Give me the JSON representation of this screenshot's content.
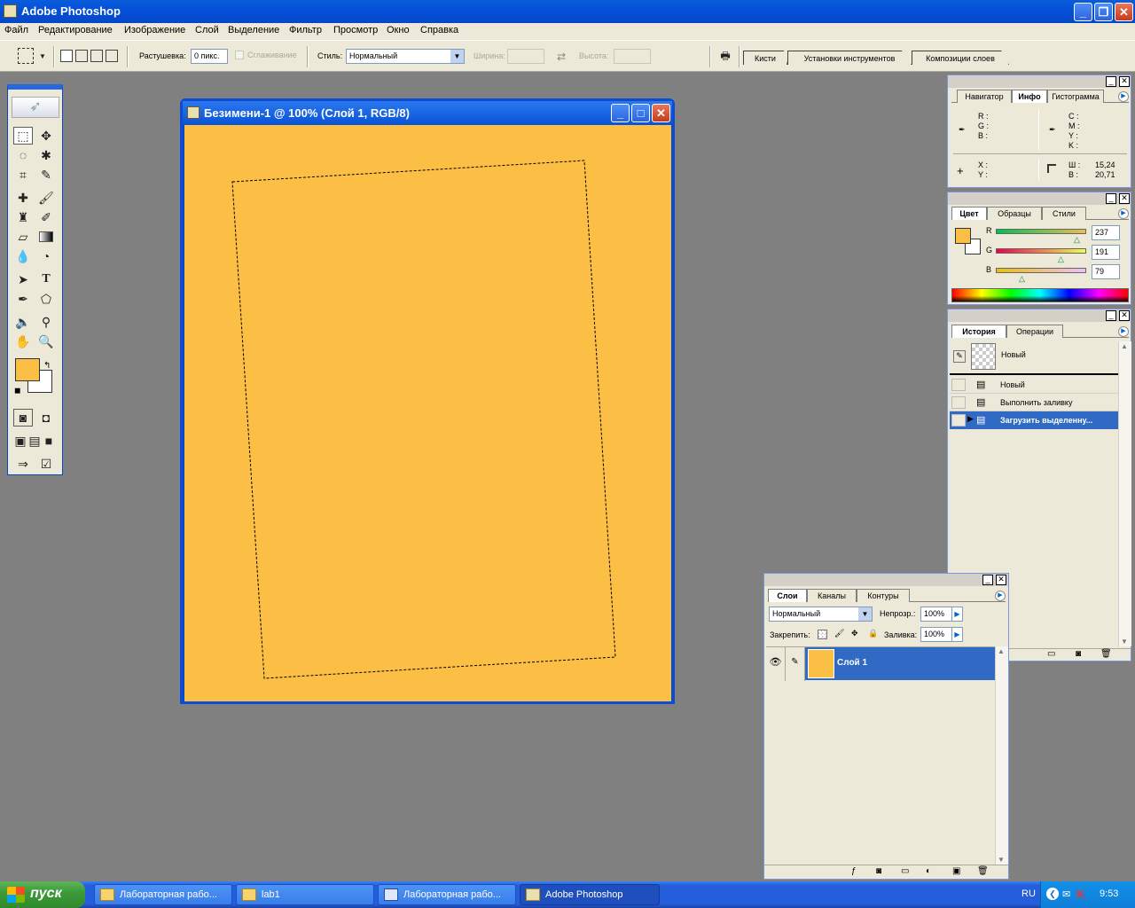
{
  "app": {
    "title": "Adobe Photoshop"
  },
  "menu": [
    "Файл",
    "Редактирование",
    "Изображение",
    "Слой",
    "Выделение",
    "Фильтр",
    "Просмотр",
    "Окно",
    "Справка"
  ],
  "options": {
    "feather_label": "Растушевка:",
    "feather_value": "0 пикс.",
    "antialias_label": "Сглаживание",
    "style_label": "Стиль:",
    "style_value": "Нормальный",
    "width_label": "Ширина:",
    "height_label": "Высота:",
    "wells": [
      "Кисти",
      "Установки инструментов",
      "Композиции слоев"
    ]
  },
  "document": {
    "title": "Безимени-1 @ 100% (Слой 1, RGB/8)",
    "fill_color": "#fcbf45"
  },
  "info_panel": {
    "tabs": [
      "Навигатор",
      "Инфо",
      "Гистограмма"
    ],
    "active_tab": "Инфо",
    "rgb_labels": [
      "R :",
      "G :",
      "B :"
    ],
    "cmyk_labels": [
      "C :",
      "M :",
      "Y :",
      "K :"
    ],
    "xy_labels": [
      "X :",
      "Y :"
    ],
    "wh_labels": [
      "Ш :",
      "В :"
    ],
    "w_value": "15,24",
    "h_value": "20,71"
  },
  "color_panel": {
    "tabs": [
      "Цвет",
      "Образцы",
      "Стили"
    ],
    "active_tab": "Цвет",
    "r_label": "R",
    "g_label": "G",
    "b_label": "B",
    "r": "237",
    "g": "191",
    "b": "79",
    "foreground": "#fcbf45",
    "background": "#ffffff"
  },
  "history_panel": {
    "tabs": [
      "История",
      "Операции"
    ],
    "active_tab": "История",
    "snapshot": "Новый",
    "items": [
      "Новый",
      "Выполнить заливку",
      "Загрузить выделенну..."
    ]
  },
  "layers_panel": {
    "tabs": [
      "Слои",
      "Каналы",
      "Контуры"
    ],
    "active_tab": "Слои",
    "blend_mode": "Нормальный",
    "opacity_label": "Непрозр.:",
    "opacity": "100%",
    "lock_label": "Закрепить:",
    "fill_label": "Заливка:",
    "fill": "100%",
    "layer_name": "Слой 1"
  },
  "taskbar": {
    "start": "пуск",
    "tasks": [
      "Лабораторная рабо...",
      "lab1",
      "Лабораторная рабо...",
      "Adobe Photoshop"
    ],
    "active_task": 3,
    "lang": "RU",
    "clock": "9:53"
  }
}
